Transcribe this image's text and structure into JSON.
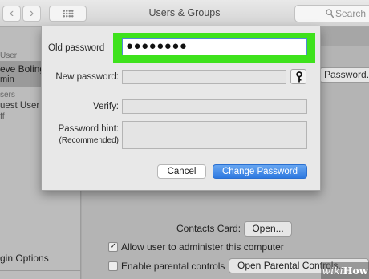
{
  "window": {
    "title": "Users & Groups",
    "back_glyph": "‹",
    "forward_glyph": "›",
    "search_placeholder": "Search"
  },
  "sidebar": {
    "current_user_header": "User",
    "current_user_name": "eve Boling",
    "current_user_role": "min",
    "other_users_header": "sers",
    "guest_user": "uest User",
    "guest_status": "ff",
    "login_options": "gin Options"
  },
  "main": {
    "password_button": "Password...",
    "contacts_card_label": "Contacts Card:",
    "open_button": "Open...",
    "allow_admin_checked": true,
    "allow_admin_label": "Allow user to administer this computer",
    "parental_checked": false,
    "parental_label": "Enable parental controls",
    "open_parental_button": "Open Parental Controls..."
  },
  "dialog": {
    "old_password_label": "Old password",
    "old_password_value": "●●●●●●●●",
    "new_password_label": "New password:",
    "new_password_value": "",
    "verify_label": "Verify:",
    "verify_value": "",
    "hint_label": "Password hint:",
    "hint_sublabel": "(Recommended)",
    "hint_value": "",
    "cancel_button": "Cancel",
    "change_button": "Change Password"
  },
  "watermark": {
    "wiki": "wiki",
    "how": "How"
  },
  "colors": {
    "highlight": "#3ee21c",
    "primary_button": "#2e79e0",
    "focus_ring": "#4f89d6"
  }
}
